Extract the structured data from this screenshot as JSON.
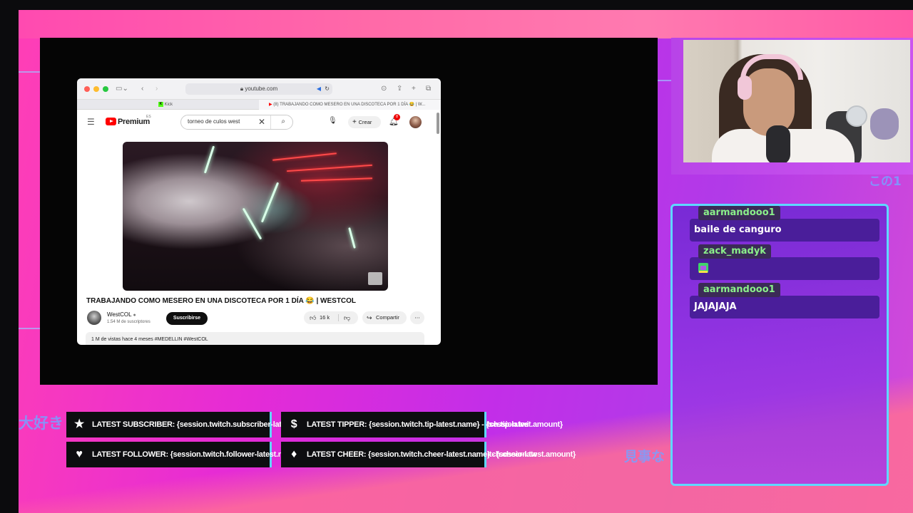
{
  "browser": {
    "address": "youtube.com",
    "tabs": [
      {
        "label": "Kick"
      },
      {
        "label": "(8) TRABAJANDO COMO MESERO EN UNA DISCOTECA POR 1 DÍA 😂 | W..."
      }
    ]
  },
  "youtube": {
    "logo_text": "Premium",
    "logo_region": "ES",
    "search_value": "torneo de culos west",
    "create_label": "Crear",
    "notification_count": "8",
    "video_title": "TRABAJANDO COMO MESERO EN UNA DISCOTECA POR 1 DÍA 😂 | WESTCOL",
    "channel_name": "WestCOL",
    "channel_subs": "1.54 M de suscriptores",
    "subscribe_label": "Suscribirse",
    "likes": "16 k",
    "share_label": "Compartir",
    "description": "1 M de vistas  hace 4 meses  #MEDELLIN #WestCOL"
  },
  "chat": {
    "messages": [
      {
        "user": "aarmandooo1",
        "text": "baile de canguro"
      },
      {
        "user": "zack_madyk",
        "text": ""
      },
      {
        "user": "aarmandooo1",
        "text": "JAJAJAJA"
      }
    ]
  },
  "alerts": {
    "subscriber": "LATEST SUBSCRIBER: {session.twitch.subscriber-latest.name}",
    "tipper_a": "LATEST TIPPER: {session.twitch.tip-latest.name} - {session.twi",
    "tipper_b": "tch.tip-latest.amount}",
    "follower": "LATEST FOLLOWER: {session.twitch.follower-latest.name}",
    "cheer_a": "LATEST CHEER: {session.twitch.cheer-latest.name} - {session.tw",
    "cheer_b": "itch.cheer-latest.amount}"
  },
  "decor": {
    "kana_left": "大好き",
    "kana_right": "見事な",
    "kana_top": "この1"
  },
  "colors": {
    "chat_name": "#8bf08a",
    "chat_border": "#5fd8ff",
    "yt_red": "#ff0000"
  }
}
